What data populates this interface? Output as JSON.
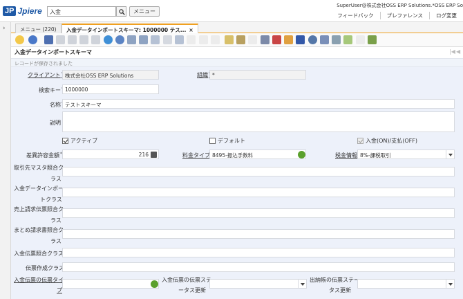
{
  "header": {
    "logo_jp": "JP",
    "logo_text": "Jpiere",
    "search_value": "入金",
    "menu_label": "メニュー",
    "user_info": "SuperUser@株式会社OSS ERP Solutions.*OSS ERP So",
    "links": [
      "フィードバック",
      "プレファレンス",
      "sign_off_label"
    ],
    "sign_off_label": "ログ変更"
  },
  "tabs": [
    {
      "label": "メニュー (220)"
    },
    {
      "label": "入金データインポートスキーマ: 1000000 テス...",
      "close": "×"
    }
  ],
  "window": {
    "title": "入金データインポートスキーマ",
    "status": "レコードが保存されました",
    "nav_first": "|◀",
    "nav_prev": "◀"
  },
  "form": {
    "client_label": "クライアント",
    "client_value": "株式会社OSS ERP Solutions",
    "org_label": "組織",
    "org_value": "*",
    "search_key_label": "検索キー",
    "search_key_value": "1000000",
    "name_label": "名称",
    "name_value": "テストスキーマ",
    "description_label": "説明",
    "description_value": "",
    "active_label": "アクティブ",
    "default_label": "デフォルト",
    "receipt_label": "入金(ON)/支払(OFF)",
    "tolerance_label": "差異許容金額",
    "tolerance_value": "216",
    "charge_type_label": "料金タイプ",
    "charge_type_value": "8495-振込手数料",
    "tax_label": "税金情報",
    "tax_value": "8%-課税取引",
    "bp_master_label_1": "取引先マスタ照合ク",
    "bp_master_label_2": "ラス",
    "import_label_1": "入金データインポー",
    "import_label_2": "トクラス",
    "invoice_label_1": "売上請求伝票照合ク",
    "invoice_label_2": "ラス",
    "consolidated_label_1": "まとめ請求書照合ク",
    "consolidated_label_2": "ラス",
    "receipt_doc_label": "入金伝票照合クラス",
    "doc_create_label": "伝票作成クラス",
    "receipt_doctype_label_1": "入金伝票の伝票タイ",
    "receipt_doctype_label_2": "プ",
    "receipt_docstatus_label_1": "入金伝票の伝票ステ",
    "receipt_docstatus_label_2": "ータス更新",
    "cashbook_docstatus_label_1": "出納帳の伝票ステー",
    "cashbook_docstatus_label_2": "タス更新"
  },
  "colors": {
    "accent": "#f0a020",
    "form_bg": "#edf1fa",
    "brand": "#1f5aa6"
  }
}
